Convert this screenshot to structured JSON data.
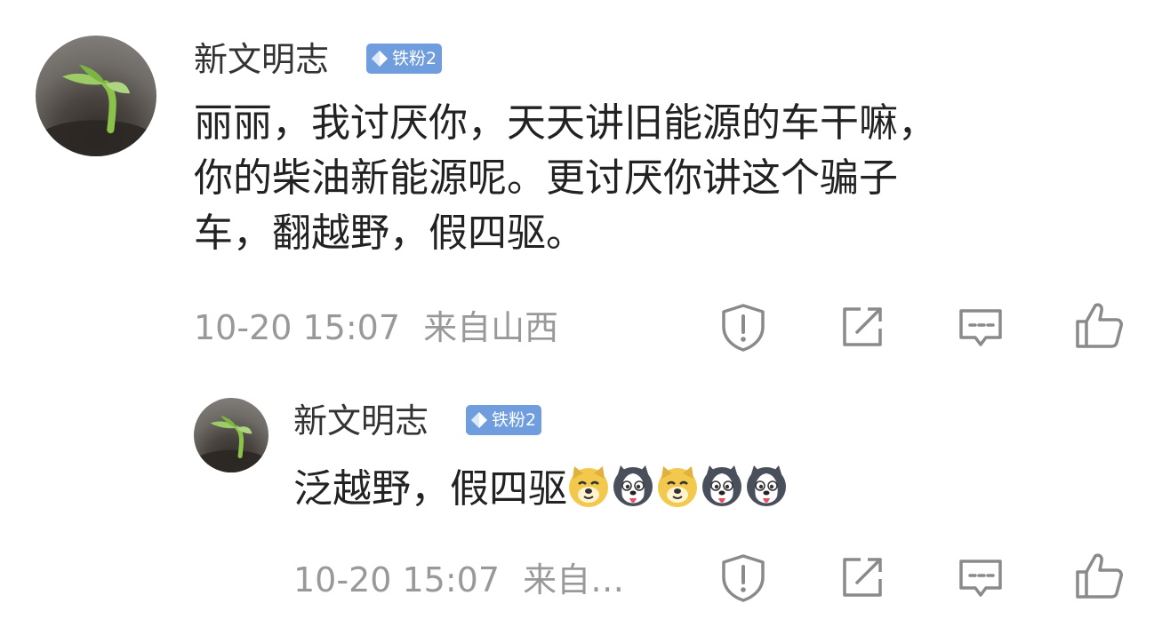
{
  "comment": {
    "username": "新文明志",
    "badge": "铁粉2",
    "text_lines": [
      "丽丽，我讨厌你，天天讲旧能源的车干嘛，",
      "你的柴油新能源呢。更讨厌你讲这个骗子",
      "车，翻越野，假四驱。"
    ],
    "time": "10-20 15:07",
    "location": "来自山西"
  },
  "reply": {
    "username": "新文明志",
    "badge": "铁粉2",
    "text": "泛越野，假四驱",
    "emojis": [
      "doge-emoji",
      "husky-emoji",
      "doge-emoji",
      "husky-emoji",
      "husky-emoji"
    ],
    "time": "10-20 15:07",
    "location": "来自…"
  },
  "icons": {
    "report": "report-icon",
    "repost": "repost-icon",
    "reply": "comment-icon",
    "like": "like-icon",
    "accent": "#6f9dde",
    "meta_color": "#999999"
  }
}
